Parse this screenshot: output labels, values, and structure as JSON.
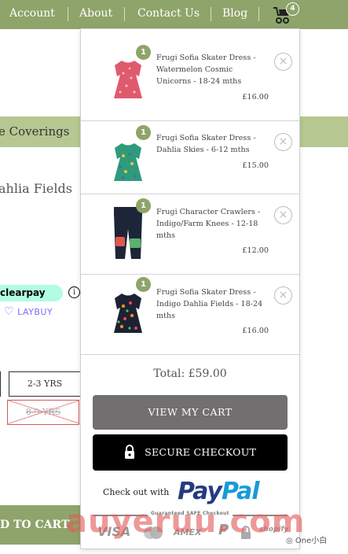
{
  "nav": {
    "items": [
      "Account",
      "About",
      "Contact Us",
      "Blog"
    ],
    "cart_count": "4"
  },
  "background_page": {
    "band_text": "e Coverings",
    "product_title": "ahlia Fields",
    "clearpay_label": "clearpay",
    "info_glyph": "i",
    "laybuy_label": "LAYBUY",
    "sizes": [
      {
        "label": "2-3 YRS",
        "available": true
      },
      {
        "label": "8-9 YRS",
        "available": false
      }
    ],
    "add_to_cart": "D TO CART"
  },
  "cart": {
    "items": [
      {
        "qty": "1",
        "name": "Frugi Sofia Skater Dress - Watermelon Cosmic Unicorns - 18-24 mths",
        "price": "£16.00",
        "thumb": "pink-dress"
      },
      {
        "qty": "1",
        "name": "Frugi Sofia Skater Dress - Dahlia Skies - 6-12 mths",
        "price": "£15.00",
        "thumb": "green-dress"
      },
      {
        "qty": "1",
        "name": "Frugi Character Crawlers - Indigo/Farm Knees - 12-18 mths",
        "price": "£12.00",
        "thumb": "crawlers"
      },
      {
        "qty": "1",
        "name": "Frugi Sofia Skater Dress - Indigo Dahlia Fields - 18-24 mths",
        "price": "£16.00",
        "thumb": "dark-dress"
      }
    ],
    "remove_glyph": "×",
    "total": "Total: £59.00",
    "view_cart_label": "VIEW MY CART",
    "checkout_label": "SECURE CHECKOUT",
    "paypal_with": "Check out with",
    "paypal_pay": "Pay",
    "paypal_pal": "Pal",
    "trust_label": "Guaranteed SAFE Checkout",
    "trust_logos": [
      "VISA",
      "AMEX",
      "P",
      "shopify"
    ]
  },
  "watermark": "auyeruu.com",
  "wechat_mark": "One小白",
  "colors": {
    "brand_green": "#8ea46a",
    "band_green": "#b6c791",
    "view_cart_gray": "#716f70",
    "checkout_black": "#000000",
    "paypal_dark": "#253b80",
    "paypal_light": "#179bd7",
    "watermark_red": "#e25a5a"
  }
}
